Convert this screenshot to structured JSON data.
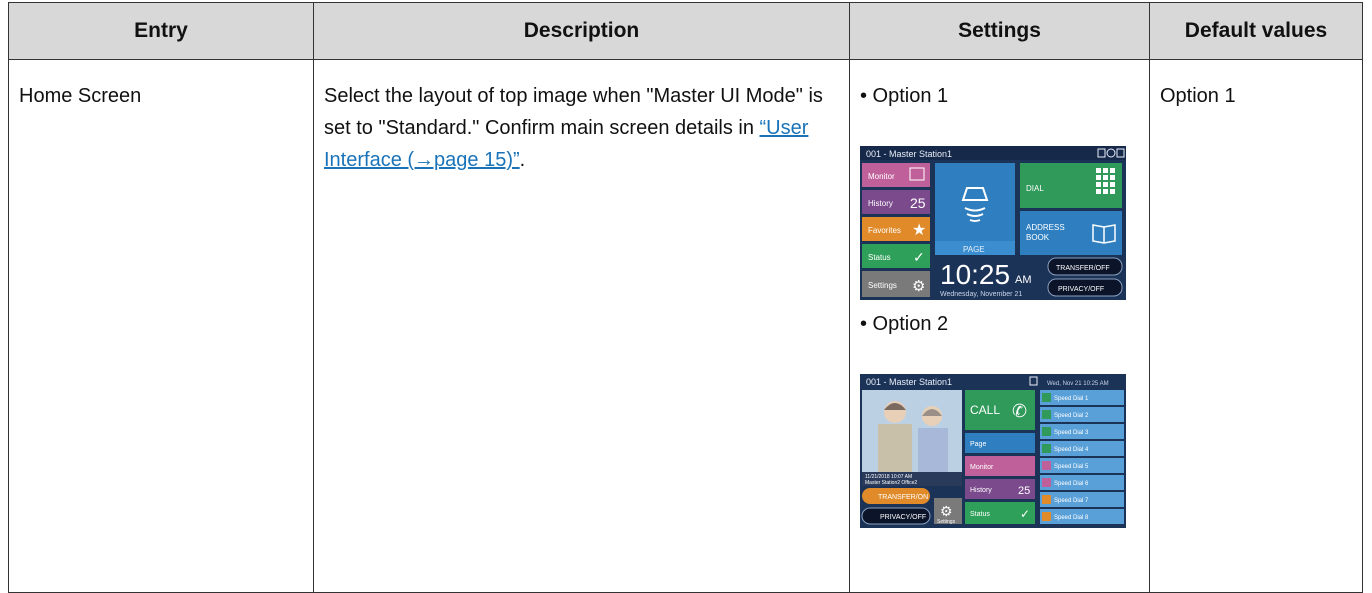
{
  "table": {
    "headers": [
      "Entry",
      "Description",
      "Settings",
      "Default values"
    ],
    "row": {
      "entry": "Home Screen",
      "description_text": "Select the layout of top image when \"Master UI Mode\" is set to \"Standard.\" Confirm main screen details in",
      "description_link": "“User Interface (→page 15)”",
      "description_end": ".",
      "default": "Option 1",
      "settings": {
        "option1_label": "• Option 1",
        "option2_label": "• Option 2"
      }
    }
  },
  "option1_screen": {
    "title": "001 - Master Station1",
    "menu": [
      "Monitor",
      "History",
      "Favorites",
      "Status",
      "Settings"
    ],
    "history_count": "25",
    "page_label": "PAGE",
    "dial_label": "DIAL",
    "address_label_1": "ADDRESS",
    "address_label_2": "BOOK",
    "time": "10:25",
    "ampm": "AM",
    "date": "Wednesday, November 21",
    "transfer": "TRANSFER/OFF",
    "privacy": "PRIVACY/OFF"
  },
  "option2_screen": {
    "title": "001 - Master Station1",
    "datetime": "Wed, Nov 21 10:25 AM",
    "call_label": "CALL",
    "page_label": "Page",
    "monitor_label": "Monitor",
    "history_label": "History",
    "history_count": "25",
    "status_label": "Status",
    "settings_label": "Settings",
    "photo_line1": "11/21/2018 10:07 AM",
    "photo_line2": "Master Station2 Office2",
    "transfer": "TRANSFER/ON",
    "privacy": "PRIVACY/OFF",
    "speed_dials": [
      "Speed Dial 1",
      "Speed Dial 2",
      "Speed Dial 3",
      "Speed Dial 4",
      "Speed Dial 5",
      "Speed Dial 6",
      "Speed Dial 7",
      "Speed Dial 8"
    ]
  },
  "colors": {
    "header_bg": "#d8d8d8",
    "link": "#1a73b8",
    "screen_bg": "#1f3860",
    "monitor": "#c0609a",
    "history": "#7a4a8c",
    "favorites": "#e08a2a",
    "status": "#2fa05a",
    "settings": "#7a7a7a",
    "page": "#2f7fc0",
    "dial": "#2f9a5a",
    "speed": "#5aa0d8"
  }
}
